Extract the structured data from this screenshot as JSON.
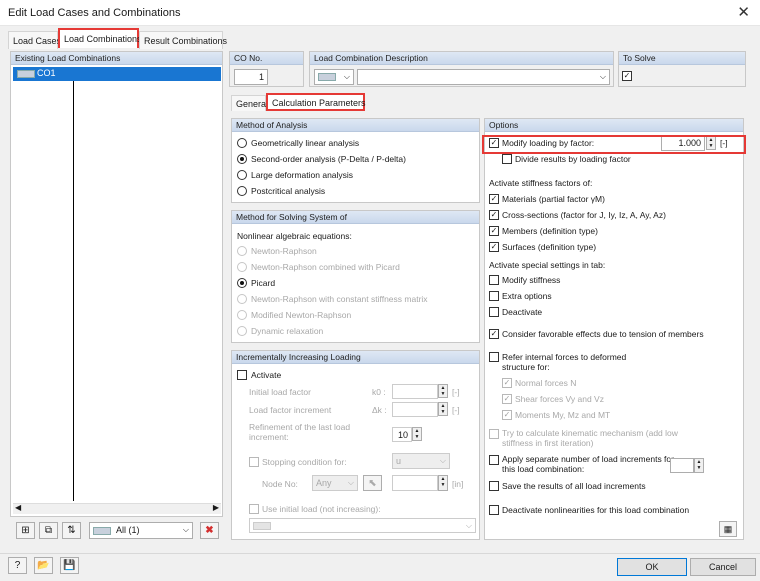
{
  "window": {
    "title": "Edit Load Cases and Combinations",
    "close_icon": "close-icon"
  },
  "tabs": [
    "Load Cases",
    "Load Combinations",
    "Result Combinations"
  ],
  "left": {
    "header": "Existing Load Combinations",
    "items": [
      {
        "label": "CO1"
      }
    ],
    "filter": "All (1)"
  },
  "top": {
    "co_no_label": "CO No.",
    "co_no": "1",
    "desc_label": "Load Combination Description",
    "to_solve_label": "To Solve"
  },
  "subtabs": [
    "General",
    "Calculation Parameters"
  ],
  "analysis": {
    "header": "Method of Analysis",
    "options": [
      "Geometrically linear analysis",
      "Second-order analysis (P-Delta / P-delta)",
      "Large deformation analysis",
      "Postcritical analysis"
    ],
    "selected": 1
  },
  "solving": {
    "header": "Method for Solving System of",
    "sub": "Nonlinear algebraic equations:",
    "options": [
      "Newton-Raphson",
      "Newton-Raphson combined with Picard",
      "Picard",
      "Newton-Raphson with constant stiffness matrix",
      "Modified Newton-Raphson",
      "Dynamic relaxation"
    ],
    "selected": 2
  },
  "incremental": {
    "header": "Incrementally Increasing Loading",
    "activate": "Activate",
    "initial": "Initial load factor",
    "initial_sym": "k0 :",
    "initial_unit": "[-]",
    "increment": "Load factor increment",
    "increment_sym": "Δk :",
    "increment_unit": "[-]",
    "refine": "Refinement of the last load increment:",
    "refine_val": "10",
    "stopping": "Stopping condition for:",
    "stop_sel": "u",
    "node": "Node No:",
    "node_sel": "Any",
    "node_unit": "[in]",
    "use_initial": "Use initial load (not increasing):"
  },
  "options": {
    "header": "Options",
    "modify": "Modify loading by factor:",
    "factor": "1.000",
    "factor_unit": "[-]",
    "divide": "Divide results by loading factor",
    "stiff_hdr": "Activate stiffness factors of:",
    "stiff": [
      "Materials (partial factor γM)",
      "Cross-sections (factor for J, Iy, Iz, A, Ay, Az)",
      "Members (definition type)",
      "Surfaces (definition type)"
    ],
    "special_hdr": "Activate special settings in tab:",
    "special": [
      "Modify stiffness",
      "Extra options",
      "Deactivate"
    ],
    "favorable": "Consider favorable effects due to tension of members",
    "refer": "Refer internal forces to deformed structure for:",
    "refer_items": [
      "Normal forces N",
      "Shear forces Vy and Vz",
      "Moments My, Mz and MT"
    ],
    "kinematic": "Try to calculate kinematic mechanism (add low stiffness in first iteration)",
    "separate": "Apply separate number of load increments for this load combination:",
    "save": "Save the results of all load increments",
    "deactivate_nl": "Deactivate nonlinearities for this load combination"
  },
  "footer": {
    "ok": "OK",
    "cancel": "Cancel"
  }
}
